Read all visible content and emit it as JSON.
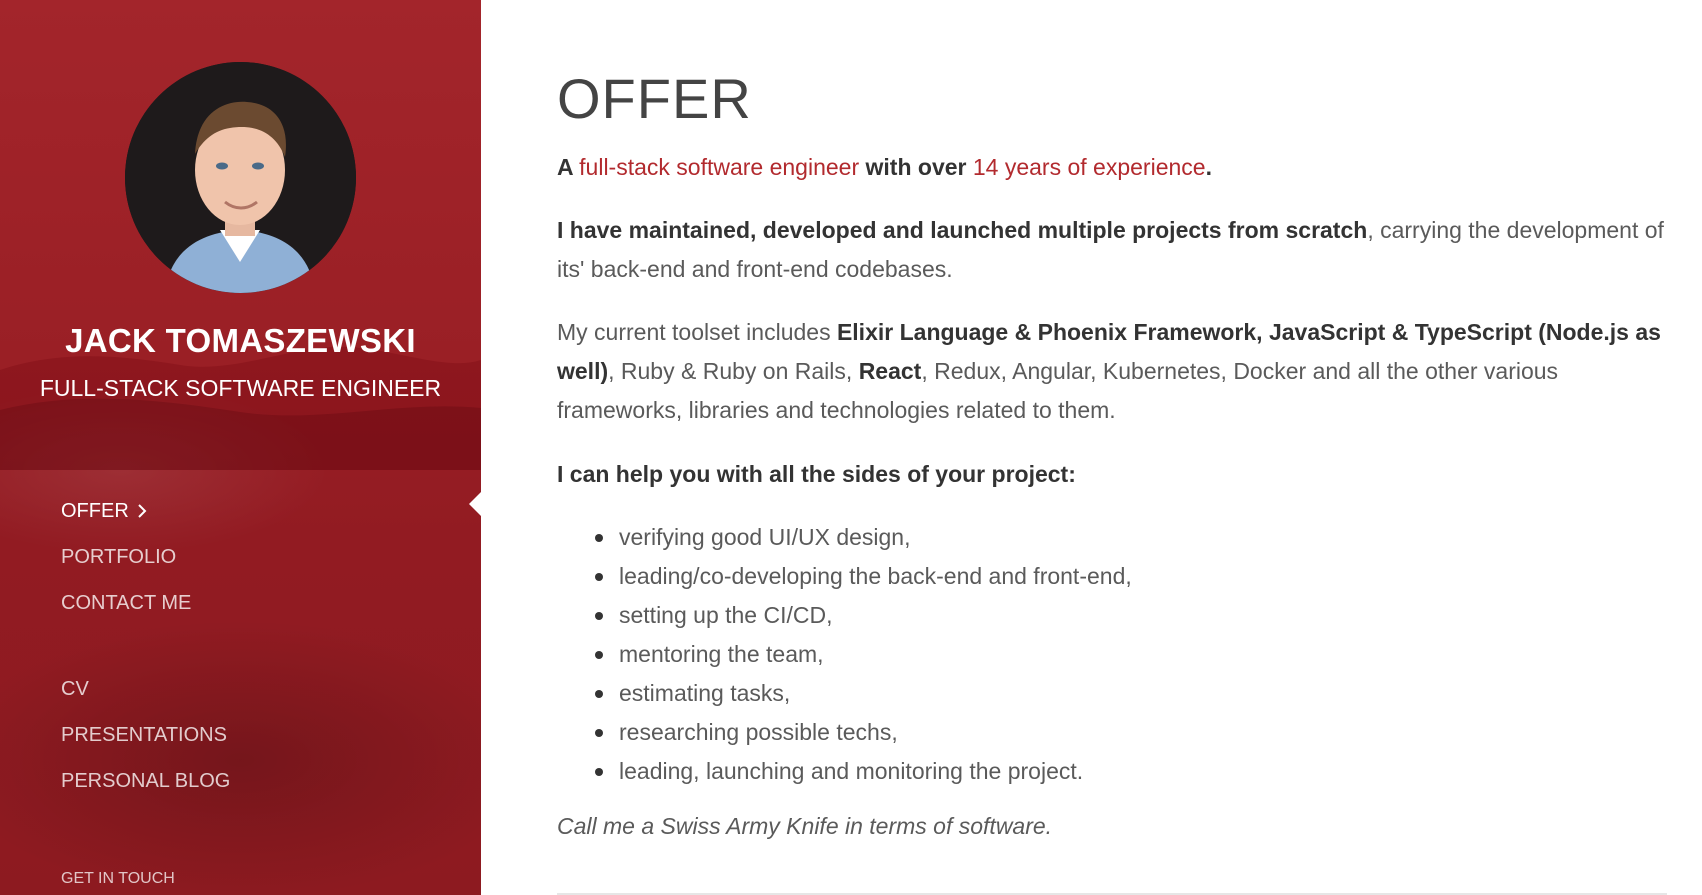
{
  "sidebar": {
    "name": "JACK TOMASZEWSKI",
    "role": "FULL-STACK SOFTWARE ENGINEER",
    "nav_primary": [
      {
        "label": "OFFER",
        "active": true
      },
      {
        "label": "PORTFOLIO",
        "active": false
      },
      {
        "label": "CONTACT ME",
        "active": false
      }
    ],
    "nav_secondary": [
      {
        "label": "CV"
      },
      {
        "label": "PRESENTATIONS"
      },
      {
        "label": "PERSONAL BLOG"
      }
    ],
    "get_in_touch": "GET IN TOUCH",
    "colors": {
      "background": "#9a1f25",
      "text": "#ffffff"
    }
  },
  "main": {
    "heading": "OFFER",
    "lead": {
      "a": "A ",
      "role_highlight": "full-stack software engineer",
      "mid": " with over ",
      "experience_highlight": "14 years of experience",
      "end": "."
    },
    "p2": {
      "bold": "I have maintained, developed and launched multiple projects from scratch",
      "rest": ", carrying the development of its' back-end and front-end codebases."
    },
    "p3": {
      "intro": "My current toolset includes ",
      "bold1": "Elixir Language & Phoenix Framework, JavaScript & TypeScript (Node.js as well)",
      "mid": ", Ruby & Ruby on Rails, ",
      "bold2": "React",
      "rest": ", Redux, Angular, Kubernetes, Docker and all the other various frameworks, libraries and technologies related to them."
    },
    "p4": "I can help you with all the sides of your project:",
    "list": [
      "verifying good UI/UX design,",
      "leading/co-developing the back-end and front-end,",
      "setting up the CI/CD,",
      "mentoring the team,",
      "estimating tasks,",
      "researching possible techs,",
      "leading, launching and monitoring the project."
    ],
    "quote": "Call me a Swiss Army Knife in terms of software.",
    "colors": {
      "accent": "#b22a2e",
      "heading": "#444444",
      "body": "#5a5a5a"
    }
  }
}
